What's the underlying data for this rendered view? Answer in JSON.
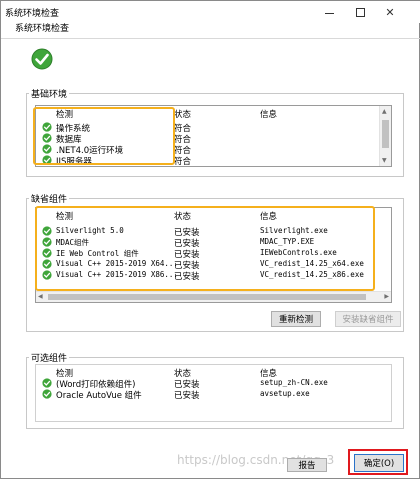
{
  "window": {
    "title": "系统环境检查"
  },
  "tab": {
    "label": "系统环境检查"
  },
  "columns": {
    "check": "检测",
    "status": "状态",
    "info": "信息"
  },
  "basic": {
    "label": "基础环境",
    "rows": [
      {
        "name": "操作系统",
        "status": "符合",
        "info": ""
      },
      {
        "name": "数据库",
        "status": "符合",
        "info": ""
      },
      {
        "name": ".NET4.0运行环境",
        "status": "符合",
        "info": ""
      },
      {
        "name": "IIS服务器",
        "status": "符合",
        "info": ""
      }
    ]
  },
  "missing": {
    "label": "缺省组件",
    "rows": [
      {
        "name": "Silverlight 5.0",
        "status": "已安装",
        "info": "Silverlight.exe"
      },
      {
        "name": "MDAC组件",
        "status": "已安装",
        "info": "MDAC_TYP.EXE"
      },
      {
        "name": "IE Web Control 组件",
        "status": "已安装",
        "info": "IEWebControls.exe"
      },
      {
        "name": "Visual C++ 2015-2019 X64...",
        "status": "已安装",
        "info": "VC_redist_14.25_x64.exe"
      },
      {
        "name": "Visual C++ 2015-2019 X86...",
        "status": "已安装",
        "info": "VC_redist_14.25_x86.exe"
      }
    ],
    "recheck_label": "重新检测",
    "install_label": "安装缺省组件"
  },
  "optional": {
    "label": "可选组件",
    "rows": [
      {
        "name": "(Word打印依赖组件)",
        "status": "已安装",
        "info": "setup_zh-CN.exe"
      },
      {
        "name": "Oracle AutoVue 组件",
        "status": "已安装",
        "info": "avsetup.exe"
      }
    ]
  },
  "footer": {
    "report_label": "报告",
    "ok_label": "确定(O)"
  },
  "watermark": "https://blog.csdn.net/qq_3",
  "colors": {
    "highlight": "#f5b01c",
    "ok_highlight": "#e0191e",
    "check_green": "#3fa53a"
  },
  "icons": {
    "status_ok": "green-check-circle-icon",
    "window_close": "close-icon",
    "window_max": "maximize-icon",
    "window_min": "minimize-icon"
  }
}
